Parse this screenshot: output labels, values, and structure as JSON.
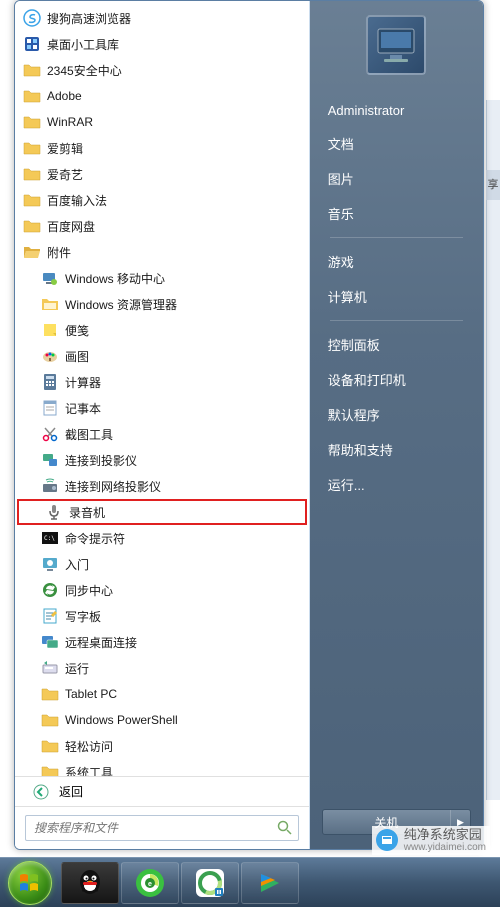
{
  "start_menu": {
    "programs": [
      {
        "name": "搜狗高速浏览器",
        "icon": "sogou",
        "indent": false
      },
      {
        "name": "桌面小工具库",
        "icon": "gadgets",
        "indent": false
      },
      {
        "name": "2345安全中心",
        "icon": "folder",
        "indent": false
      },
      {
        "name": "Adobe",
        "icon": "folder",
        "indent": false
      },
      {
        "name": "WinRAR",
        "icon": "folder",
        "indent": false
      },
      {
        "name": "爱剪辑",
        "icon": "folder",
        "indent": false
      },
      {
        "name": "爱奇艺",
        "icon": "folder",
        "indent": false
      },
      {
        "name": "百度输入法",
        "icon": "folder",
        "indent": false
      },
      {
        "name": "百度网盘",
        "icon": "folder",
        "indent": false
      },
      {
        "name": "附件",
        "icon": "folder-open",
        "indent": false
      },
      {
        "name": "Windows 移动中心",
        "icon": "mobility",
        "indent": true
      },
      {
        "name": "Windows 资源管理器",
        "icon": "explorer",
        "indent": true
      },
      {
        "name": "便笺",
        "icon": "sticky",
        "indent": true
      },
      {
        "name": "画图",
        "icon": "paint",
        "indent": true
      },
      {
        "name": "计算器",
        "icon": "calc",
        "indent": true
      },
      {
        "name": "记事本",
        "icon": "notepad",
        "indent": true
      },
      {
        "name": "截图工具",
        "icon": "snip",
        "indent": true
      },
      {
        "name": "连接到投影仪",
        "icon": "projector1",
        "indent": true
      },
      {
        "name": "连接到网络投影仪",
        "icon": "projector2",
        "indent": true
      },
      {
        "name": "录音机",
        "icon": "recorder",
        "indent": true,
        "highlighted": true
      },
      {
        "name": "命令提示符",
        "icon": "cmd",
        "indent": true
      },
      {
        "name": "入门",
        "icon": "getting-started",
        "indent": true
      },
      {
        "name": "同步中心",
        "icon": "sync",
        "indent": true
      },
      {
        "name": "写字板",
        "icon": "wordpad",
        "indent": true
      },
      {
        "name": "远程桌面连接",
        "icon": "rdp",
        "indent": true
      },
      {
        "name": "运行",
        "icon": "run",
        "indent": true
      },
      {
        "name": "Tablet PC",
        "icon": "folder",
        "indent": true
      },
      {
        "name": "Windows PowerShell",
        "icon": "folder",
        "indent": true
      },
      {
        "name": "轻松访问",
        "icon": "folder",
        "indent": true
      },
      {
        "name": "系统工具",
        "icon": "folder",
        "indent": true
      }
    ],
    "back_label": "返回",
    "search_placeholder": "搜索程序和文件",
    "right": {
      "user": "Administrator",
      "links1": [
        "文档",
        "图片",
        "音乐"
      ],
      "links2": [
        "游戏",
        "计算机"
      ],
      "links3": [
        "控制面板",
        "设备和打印机",
        "默认程序",
        "帮助和支持",
        "运行..."
      ],
      "shutdown": "关机"
    }
  },
  "taskbar": {
    "items": [
      "qq",
      "chrome-360",
      "green-app",
      "tencent-video"
    ]
  },
  "watermark": {
    "title": "纯净系统家园",
    "url": "www.yidaimei.com"
  },
  "right_edge_char": "享"
}
